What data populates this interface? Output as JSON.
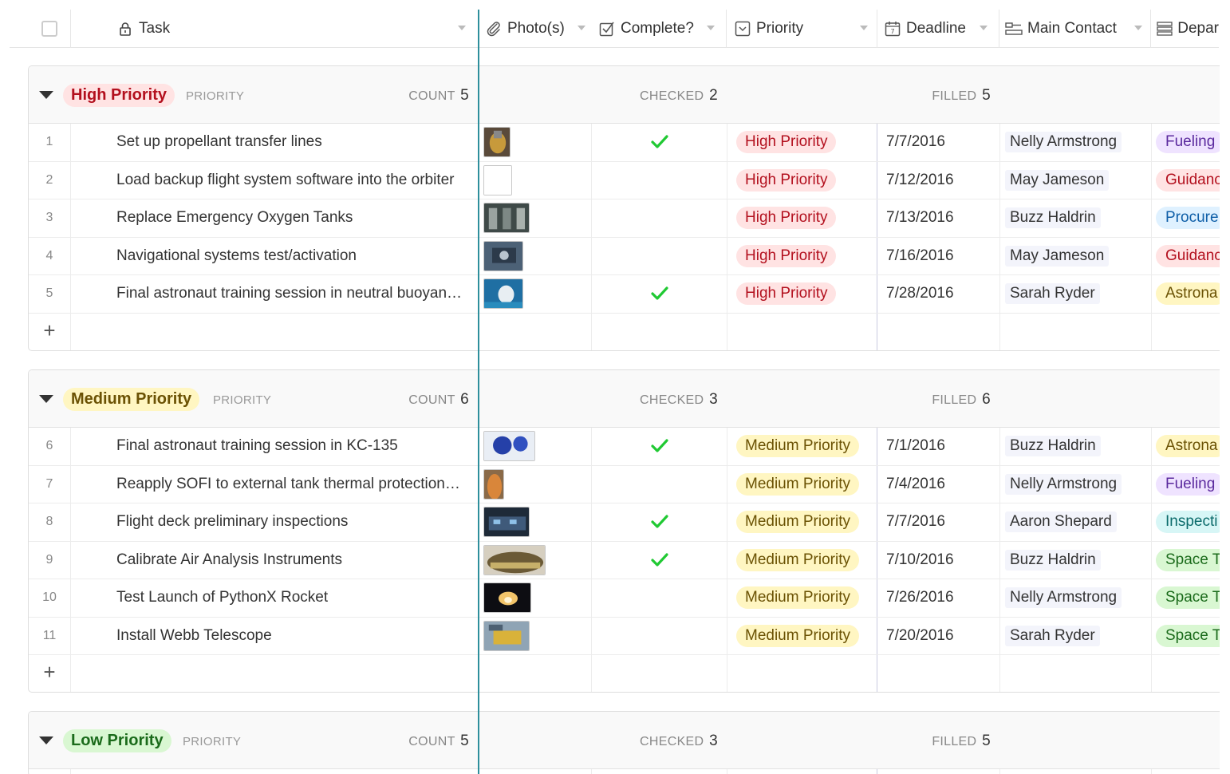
{
  "header": {
    "columns": [
      {
        "label": "Task",
        "icon": "lock-icon"
      },
      {
        "label": "Photo(s)",
        "icon": "paperclip-icon"
      },
      {
        "label": "Complete?",
        "icon": "checkbox-icon"
      },
      {
        "label": "Priority",
        "icon": "single-select-icon"
      },
      {
        "label": "Deadline",
        "icon": "calendar-icon"
      },
      {
        "label": "Main Contact",
        "icon": "link-record-icon"
      },
      {
        "label": "Depar",
        "icon": "list-icon"
      }
    ]
  },
  "colors": {
    "freeze_line": "#2e8f9c",
    "check": "#20c933",
    "high_bg": "#ffe3e3",
    "high_fg": "#b3101e",
    "medium_bg": "#fff6c2",
    "medium_fg": "#6b5204",
    "low_bg": "#d9f7d2",
    "low_fg": "#1b6b1b"
  },
  "groups": [
    {
      "label": "High Priority",
      "field": "PRIORITY",
      "count_label": "COUNT",
      "count": "5",
      "checked_label": "CHECKED",
      "checked": "2",
      "filled_label": "FILLED",
      "filled": "5",
      "rows": [
        {
          "num": "1",
          "task": "Set up propellant transfer lines",
          "photo": "rocket-engine",
          "complete": true,
          "priority": "High Priority",
          "deadline": "7/7/2016",
          "contact": "Nelly Armstrong",
          "dept": "Fueling",
          "dept_color": "purple"
        },
        {
          "num": "2",
          "task": "Load backup flight system software into the orbiter",
          "photo": "blank",
          "complete": false,
          "priority": "High Priority",
          "deadline": "7/12/2016",
          "contact": "May Jameson",
          "dept": "Guidanc",
          "dept_color": "red"
        },
        {
          "num": "3",
          "task": "Replace Emergency Oxygen Tanks",
          "photo": "tanks",
          "complete": false,
          "priority": "High Priority",
          "deadline": "7/13/2016",
          "contact": "Buzz Haldrin",
          "dept": "Procure",
          "dept_color": "blue"
        },
        {
          "num": "4",
          "task": "Navigational systems test/activation",
          "photo": "console",
          "complete": false,
          "priority": "High Priority",
          "deadline": "7/16/2016",
          "contact": "May Jameson",
          "dept": "Guidanc",
          "dept_color": "red"
        },
        {
          "num": "5",
          "task": "Final astronaut training session in neutral buoyan…",
          "photo": "underwater",
          "complete": true,
          "priority": "High Priority",
          "deadline": "7/28/2016",
          "contact": "Sarah Ryder",
          "dept": "Astrona",
          "dept_color": "yellow"
        }
      ]
    },
    {
      "label": "Medium Priority",
      "field": "PRIORITY",
      "count_label": "COUNT",
      "count": "6",
      "checked_label": "CHECKED",
      "checked": "3",
      "filled_label": "FILLED",
      "filled": "6",
      "rows": [
        {
          "num": "6",
          "task": "Final astronaut training session in KC-135",
          "photo": "zero-g",
          "complete": true,
          "priority": "Medium Priority",
          "deadline": "7/1/2016",
          "contact": "Buzz Haldrin",
          "dept": "Astrona",
          "dept_color": "yellow"
        },
        {
          "num": "7",
          "task": "Reapply SOFI to external tank thermal protection…",
          "photo": "external-tank",
          "complete": false,
          "priority": "Medium Priority",
          "deadline": "7/4/2016",
          "contact": "Nelly Armstrong",
          "dept": "Fueling",
          "dept_color": "purple"
        },
        {
          "num": "8",
          "task": "Flight deck preliminary inspections",
          "photo": "cockpit",
          "complete": true,
          "priority": "Medium Priority",
          "deadline": "7/7/2016",
          "contact": "Aaron Shepard",
          "dept": "Inspecti",
          "dept_color": "cyan"
        },
        {
          "num": "9",
          "task": "Calibrate Air Analysis Instruments",
          "photo": "instrument",
          "complete": true,
          "priority": "Medium Priority",
          "deadline": "7/10/2016",
          "contact": "Buzz Haldrin",
          "dept": "Space T",
          "dept_color": "green"
        },
        {
          "num": "10",
          "task": "Test Launch of PythonX Rocket",
          "photo": "launch",
          "complete": false,
          "priority": "Medium Priority",
          "deadline": "7/26/2016",
          "contact": "Nelly Armstrong",
          "dept": "Space T",
          "dept_color": "green"
        },
        {
          "num": "11",
          "task": "Install Webb Telescope",
          "photo": "telescope",
          "complete": false,
          "priority": "Medium Priority",
          "deadline": "7/20/2016",
          "contact": "Sarah Ryder",
          "dept": "Space T",
          "dept_color": "green"
        }
      ]
    },
    {
      "label": "Low Priority",
      "field": "PRIORITY",
      "count_label": "COUNT",
      "count": "5",
      "checked_label": "CHECKED",
      "checked": "3",
      "filled_label": "FILLED",
      "filled": "5",
      "rows": []
    }
  ],
  "dept_colors": {
    "purple": {
      "bg": "#efe3ff",
      "fg": "#5b2a9e"
    },
    "red": {
      "bg": "#ffe3e3",
      "fg": "#b3101e"
    },
    "blue": {
      "bg": "#dff1ff",
      "fg": "#0f5fa8"
    },
    "yellow": {
      "bg": "#fff6c2",
      "fg": "#6b5204"
    },
    "cyan": {
      "bg": "#d7f6f6",
      "fg": "#0b6b6b"
    },
    "green": {
      "bg": "#d9f7d2",
      "fg": "#1b6b1b"
    }
  },
  "add_row_symbol": "+"
}
